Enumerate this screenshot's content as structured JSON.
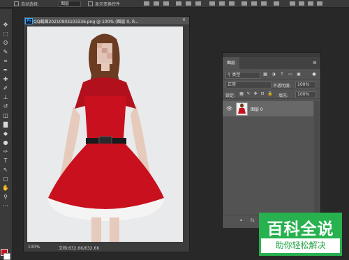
{
  "options_bar": {
    "auto_select_label": "自动选择:",
    "auto_select_value": "图层",
    "show_transform_label": "显示变换控件"
  },
  "toolbox": {
    "tools": [
      "move-tool",
      "marquee-tool",
      "lasso-tool",
      "quick-select-tool",
      "crop-tool",
      "eyedropper-tool",
      "healing-brush-tool",
      "brush-tool",
      "clone-stamp-tool",
      "history-brush-tool",
      "eraser-tool",
      "gradient-tool",
      "blur-tool",
      "dodge-tool",
      "pen-tool",
      "type-tool",
      "path-select-tool",
      "rectangle-tool",
      "hand-tool",
      "zoom-tool",
      "more-tools"
    ],
    "glyphs": [
      "✥",
      "⬚",
      "ʘ",
      "✎",
      "⌗",
      "✒",
      "✚",
      "✐",
      "⊥",
      "↺",
      "◫",
      "▇",
      "◆",
      "●",
      "✑",
      "T",
      "↖",
      "▢",
      "✋",
      "⚲",
      "···"
    ],
    "foreground_color": "#c8101e",
    "background_color": "#ffffff"
  },
  "document": {
    "badge": "Ps",
    "tab_title": "QQ截图20210903103336.png @ 100% (图层 0, R...",
    "close_glyph": "×",
    "zoom": "100%",
    "doc_size": "文档:632.6K/632.6K"
  },
  "layers_panel": {
    "tab_label": "图层",
    "menu_glyph": "≡",
    "filter_kind": "类型",
    "blend_mode": "正常",
    "opacity_label": "不透明度:",
    "opacity_value": "100%",
    "lock_label": "锁定:",
    "fill_label": "填充:",
    "fill_value": "100%",
    "layers": [
      {
        "name": "图层 0",
        "visible": true
      }
    ],
    "footer_icons": [
      "link-icon",
      "fx-icon"
    ],
    "footer_glyphs": [
      "⚭",
      "fx"
    ]
  },
  "watermark": {
    "title": "百科全说",
    "subtitle": "助你轻松解决",
    "color": "#27b14f"
  }
}
